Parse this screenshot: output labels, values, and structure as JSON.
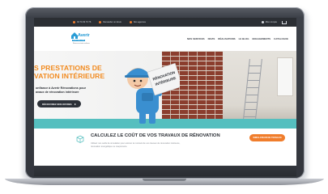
{
  "topbar": {
    "items": [
      {
        "icon": "phone-icon",
        "label": "04 73 29 73 76"
      },
      {
        "icon": "calendar-icon",
        "label": "Demander un devis"
      },
      {
        "icon": "location-icon",
        "label": "Nos agences"
      }
    ],
    "account_label": "Mon compte",
    "cart_icon": "cart-icon"
  },
  "header": {
    "logo_text": "Averir",
    "logo_sub": "RÉNOVATIONS",
    "logo_tag": "Rénover en toute confiance",
    "nav": [
      "NOS SERVICES",
      "DEVIS",
      "RÉALISATIONS",
      "LE BLOG",
      "ENGAGEMENTS",
      "CATALOGUE"
    ]
  },
  "hero": {
    "title_line1": "S PRESTATIONS DE",
    "title_line2": "VATION INTÉRIEURE",
    "text_line1": "onfiance à Averir Rénovations pour",
    "text_line2": "avaux de rénovation intérieure",
    "cta_label": "DÉCOUVREZ NOS OFFRES",
    "sign_line1": "RÉNOVATION",
    "sign_line2": "INTÉRIEURE"
  },
  "calculator": {
    "title": "CALCULEZ LE COÛT DE VOS TRAVAUX DE RÉNOVATION",
    "desc_line1": "Utilisez nos outils de simulation pour estimer le montant de vos travaux de rénovation intérieure,",
    "desc_line2": "rénovation énergétique ou maçonnerie.",
    "button_label": "SIMULATEUR DE TRAVAUX",
    "icon": "cube-icon"
  },
  "colors": {
    "accent": "#f07d2c",
    "brand_blue": "#2a9dd6",
    "teal": "#55bfbf",
    "topbar": "#2b2e33"
  }
}
